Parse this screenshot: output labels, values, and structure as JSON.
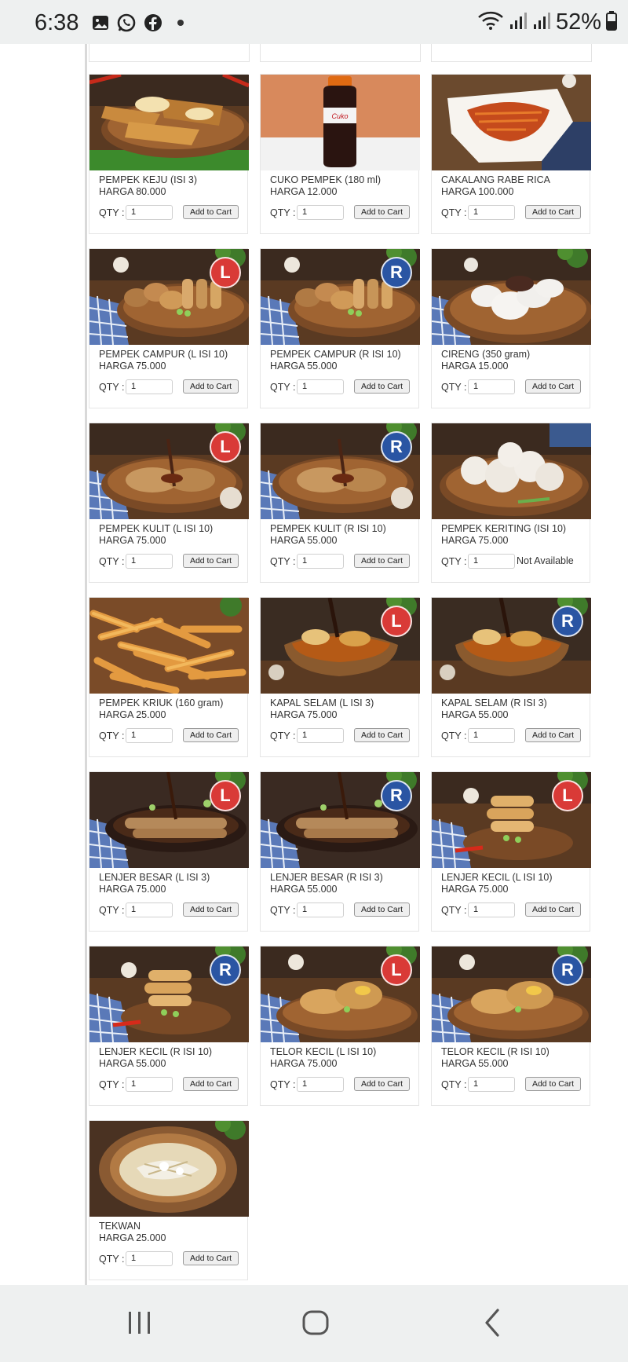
{
  "status_bar": {
    "time": "6:38",
    "battery": "52%",
    "notification_icons": [
      "gallery-icon",
      "whatsapp-icon",
      "facebook-icon",
      "dot-icon"
    ],
    "system_icons": [
      "wifi-icon",
      "signal-icon",
      "signal-icon",
      "battery-icon"
    ]
  },
  "products": [
    {
      "name": "PEMPEK KEJU (ISI 3)",
      "price": "HARGA 80.000",
      "qty_label": "QTY :",
      "qty": "1",
      "button": "Add to Cart",
      "badge": "",
      "image": "fried-pempek-cheese"
    },
    {
      "name": "CUKO PEMPEK (180 ml)",
      "price": "HARGA 12.000",
      "qty_label": "QTY :",
      "qty": "1",
      "button": "Add to Cart",
      "badge": "",
      "image": "cuko-bottle"
    },
    {
      "name": "CAKALANG RABE RICA",
      "price": "HARGA 100.000",
      "qty_label": "QTY :",
      "qty": "1",
      "button": "Add to Cart",
      "badge": "",
      "image": "shredded-fish-bowl"
    },
    {
      "name": "PEMPEK CAMPUR (L ISI 10)",
      "price": "HARGA 75.000",
      "qty_label": "QTY :",
      "qty": "1",
      "button": "Add to Cart",
      "badge": "L",
      "image": "mixed-pempek"
    },
    {
      "name": "PEMPEK CAMPUR (R ISI 10)",
      "price": "HARGA 55.000",
      "qty_label": "QTY :",
      "qty": "1",
      "button": "Add to Cart",
      "badge": "R",
      "image": "mixed-pempek"
    },
    {
      "name": "CIRENG (350 gram)",
      "price": "HARGA 15.000",
      "qty_label": "QTY :",
      "qty": "1",
      "button": "Add to Cart",
      "badge": "",
      "image": "cireng"
    },
    {
      "name": "PEMPEK KULIT (L ISI 10)",
      "price": "HARGA 75.000",
      "qty_label": "QTY :",
      "qty": "1",
      "button": "Add to Cart",
      "badge": "L",
      "image": "pempek-kulit"
    },
    {
      "name": "PEMPEK KULIT (R ISI 10)",
      "price": "HARGA 55.000",
      "qty_label": "QTY :",
      "qty": "1",
      "button": "Add to Cart",
      "badge": "R",
      "image": "pempek-kulit"
    },
    {
      "name": "PEMPEK KERITING (ISI 10)",
      "price": "HARGA 75.000",
      "qty_label": "QTY :",
      "qty": "1",
      "button": "",
      "badge": "",
      "status": "Not Available",
      "image": "pempek-keriting"
    },
    {
      "name": "PEMPEK KRIUK (160 gram)",
      "price": "HARGA 25.000",
      "qty_label": "QTY :",
      "qty": "1",
      "button": "Add to Cart",
      "badge": "",
      "image": "pempek-kriuk"
    },
    {
      "name": "KAPAL SELAM (L ISI 3)",
      "price": "HARGA 75.000",
      "qty_label": "QTY :",
      "qty": "1",
      "button": "Add to Cart",
      "badge": "L",
      "image": "kapal-selam"
    },
    {
      "name": "KAPAL SELAM (R ISI 3)",
      "price": "HARGA 55.000",
      "qty_label": "QTY :",
      "qty": "1",
      "button": "Add to Cart",
      "badge": "R",
      "image": "kapal-selam"
    },
    {
      "name": "LENJER BESAR (L ISI 3)",
      "price": "HARGA 75.000",
      "qty_label": "QTY :",
      "qty": "1",
      "button": "Add to Cart",
      "badge": "L",
      "image": "lenjer-besar"
    },
    {
      "name": "LENJER BESAR (R ISI 3)",
      "price": "HARGA 55.000",
      "qty_label": "QTY :",
      "qty": "1",
      "button": "Add to Cart",
      "badge": "R",
      "image": "lenjer-besar"
    },
    {
      "name": "LENJER KECIL (L ISI 10)",
      "price": "HARGA 75.000",
      "qty_label": "QTY :",
      "qty": "1",
      "button": "Add to Cart",
      "badge": "L",
      "image": "lenjer-kecil"
    },
    {
      "name": "LENJER KECIL (R ISI 10)",
      "price": "HARGA 55.000",
      "qty_label": "QTY :",
      "qty": "1",
      "button": "Add to Cart",
      "badge": "R",
      "image": "lenjer-kecil"
    },
    {
      "name": "TELOR KECIL (L ISI 10)",
      "price": "HARGA 75.000",
      "qty_label": "QTY :",
      "qty": "1",
      "button": "Add to Cart",
      "badge": "L",
      "image": "telor-kecil"
    },
    {
      "name": "TELOR KECIL (R ISI 10)",
      "price": "HARGA 55.000",
      "qty_label": "QTY :",
      "qty": "1",
      "button": "Add to Cart",
      "badge": "R",
      "image": "telor-kecil"
    },
    {
      "name": "TEKWAN",
      "price": "HARGA 25.000",
      "qty_label": "QTY :",
      "qty": "1",
      "button": "Add to Cart",
      "badge": "",
      "image": "tekwan-soup"
    }
  ],
  "nav_bar": {
    "buttons": [
      "recent-apps-icon",
      "home-icon",
      "back-icon"
    ]
  },
  "colors": {
    "badge_L": "#d93a37",
    "badge_R": "#2a55a3"
  }
}
